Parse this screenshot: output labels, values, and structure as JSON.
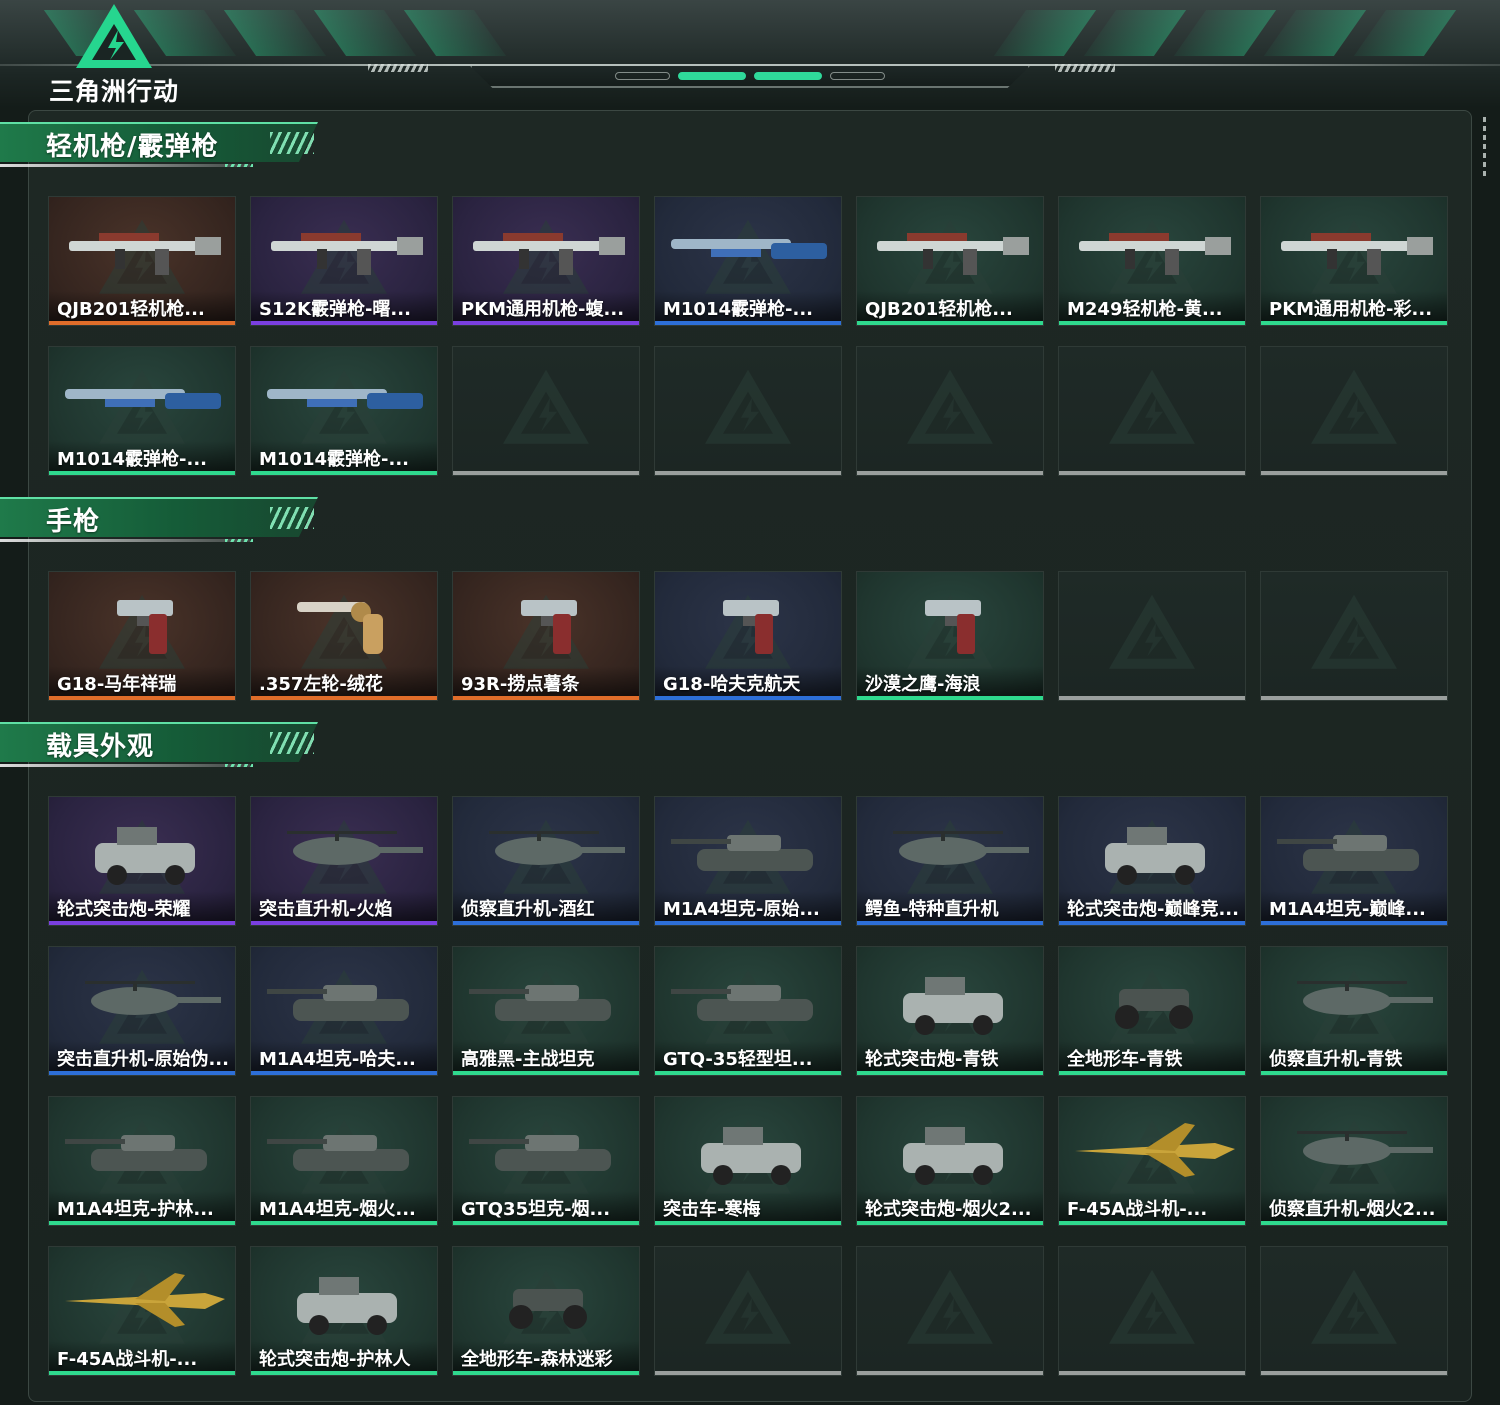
{
  "logo": {
    "text": "三角洲行动"
  },
  "colors": {
    "orange": "#e06d2a",
    "purple": "#7a3fe0",
    "blue": "#2d6fd8",
    "green": "#2fd98e",
    "gray": "#9a9f9d",
    "accent": "#2fd99a"
  },
  "sections": [
    {
      "title": "轻机枪/霰弹枪",
      "items": [
        {
          "label": "QJB201轻机枪...",
          "rarity": "orange",
          "kind": "rifle"
        },
        {
          "label": "S12K霰弹枪-曙...",
          "rarity": "purple",
          "kind": "rifle"
        },
        {
          "label": "PKM通用机枪-蝮...",
          "rarity": "purple",
          "kind": "rifle"
        },
        {
          "label": "M1014霰弹枪-...",
          "rarity": "blue",
          "kind": "shotgun"
        },
        {
          "label": "QJB201轻机枪...",
          "rarity": "green",
          "kind": "rifle"
        },
        {
          "label": "M249轻机枪-黄...",
          "rarity": "green",
          "kind": "rifle"
        },
        {
          "label": "PKM通用机枪-彩...",
          "rarity": "green",
          "kind": "rifle"
        },
        {
          "label": "M1014霰弹枪-...",
          "rarity": "green",
          "kind": "shotgun"
        },
        {
          "label": "M1014霰弹枪-...",
          "rarity": "green",
          "kind": "shotgun"
        },
        {
          "label": "",
          "rarity": "gray",
          "kind": "empty"
        },
        {
          "label": "",
          "rarity": "gray",
          "kind": "empty"
        },
        {
          "label": "",
          "rarity": "gray",
          "kind": "empty"
        },
        {
          "label": "",
          "rarity": "gray",
          "kind": "empty"
        },
        {
          "label": "",
          "rarity": "gray",
          "kind": "empty"
        }
      ]
    },
    {
      "title": "手枪",
      "items": [
        {
          "label": "G18-马年祥瑞",
          "rarity": "orange",
          "kind": "pistol"
        },
        {
          "label": ".357左轮-绒花",
          "rarity": "orange",
          "kind": "revolver"
        },
        {
          "label": "93R-捞点薯条",
          "rarity": "orange",
          "kind": "pistol"
        },
        {
          "label": "G18-哈夫克航天",
          "rarity": "blue",
          "kind": "pistol"
        },
        {
          "label": "沙漠之鹰-海浪",
          "rarity": "green",
          "kind": "pistol"
        },
        {
          "label": "",
          "rarity": "gray",
          "kind": "empty"
        },
        {
          "label": "",
          "rarity": "gray",
          "kind": "empty"
        }
      ]
    },
    {
      "title": "载具外观",
      "items": [
        {
          "label": "轮式突击炮-荣耀",
          "rarity": "purple",
          "kind": "car"
        },
        {
          "label": "突击直升机-火焰",
          "rarity": "purple",
          "kind": "heli"
        },
        {
          "label": "侦察直升机-酒红",
          "rarity": "blue",
          "kind": "heli"
        },
        {
          "label": "M1A4坦克-原始...",
          "rarity": "blue",
          "kind": "tank"
        },
        {
          "label": "鳄鱼-特种直升机",
          "rarity": "blue",
          "kind": "heli"
        },
        {
          "label": "轮式突击炮-巅峰竞...",
          "rarity": "blue",
          "kind": "car"
        },
        {
          "label": "M1A4坦克-巅峰...",
          "rarity": "blue",
          "kind": "tank"
        },
        {
          "label": "突击直升机-原始伪...",
          "rarity": "blue",
          "kind": "heli"
        },
        {
          "label": "M1A4坦克-哈夫...",
          "rarity": "blue",
          "kind": "tank"
        },
        {
          "label": "高雅黑-主战坦克",
          "rarity": "green",
          "kind": "tank"
        },
        {
          "label": "GTQ-35轻型坦...",
          "rarity": "green",
          "kind": "tank"
        },
        {
          "label": "轮式突击炮-青铁",
          "rarity": "green",
          "kind": "car"
        },
        {
          "label": "全地形车-青铁",
          "rarity": "green",
          "kind": "atv"
        },
        {
          "label": "侦察直升机-青铁",
          "rarity": "green",
          "kind": "heli"
        },
        {
          "label": "M1A4坦克-护林...",
          "rarity": "green",
          "kind": "tank"
        },
        {
          "label": "M1A4坦克-烟火...",
          "rarity": "green",
          "kind": "tank"
        },
        {
          "label": "GTQ35坦克-烟...",
          "rarity": "green",
          "kind": "tank"
        },
        {
          "label": "突击车-寒梅",
          "rarity": "green",
          "kind": "car"
        },
        {
          "label": "轮式突击炮-烟火2...",
          "rarity": "green",
          "kind": "car"
        },
        {
          "label": "F-45A战斗机-...",
          "rarity": "green",
          "kind": "jet"
        },
        {
          "label": "侦察直升机-烟火2...",
          "rarity": "green",
          "kind": "heli"
        },
        {
          "label": "F-45A战斗机-...",
          "rarity": "green",
          "kind": "jet"
        },
        {
          "label": "轮式突击炮-护林人",
          "rarity": "green",
          "kind": "car"
        },
        {
          "label": "全地形车-森林迷彩",
          "rarity": "green",
          "kind": "atv"
        },
        {
          "label": "",
          "rarity": "gray",
          "kind": "empty"
        },
        {
          "label": "",
          "rarity": "gray",
          "kind": "empty"
        },
        {
          "label": "",
          "rarity": "gray",
          "kind": "empty"
        },
        {
          "label": "",
          "rarity": "gray",
          "kind": "empty"
        }
      ]
    }
  ]
}
